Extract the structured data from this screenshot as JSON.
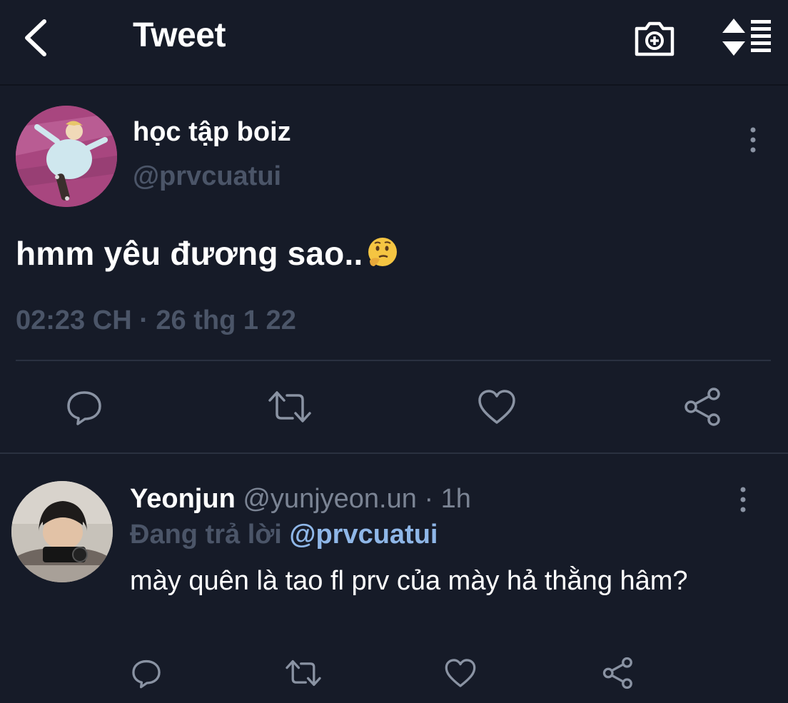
{
  "header": {
    "title": "Tweet",
    "back_icon": "chevron-left-icon",
    "camera_icon": "camera-add-icon",
    "sort_icon": "sort-list-icon"
  },
  "main_tweet": {
    "author_name": "học tập boiz",
    "author_handle": "@prvcuatui",
    "text": "hmm yêu đương sao..",
    "emoji": "thinking-face-icon",
    "timestamp": "02:23 CH · 26 thg 1 22",
    "actions": [
      "reply-icon",
      "retweet-icon",
      "like-icon",
      "share-icon"
    ]
  },
  "reply": {
    "author_name": "Yeonjun",
    "author_handle": "@yunjyeon.un",
    "dot": "·",
    "time": "1h",
    "replying_label": "Đang trả lời",
    "replying_handle": "@prvcuatui",
    "text": "mày quên là tao fl prv của mày hả thằng hâm?",
    "actions": [
      "reply-icon",
      "retweet-icon",
      "like-icon",
      "share-icon"
    ]
  },
  "colors": {
    "background": "#161b28",
    "text_primary": "#ffffff",
    "text_muted": "#4b5568",
    "text_secondary": "#7b8494",
    "link": "#8fb7e8",
    "divider": "#2a3140"
  }
}
